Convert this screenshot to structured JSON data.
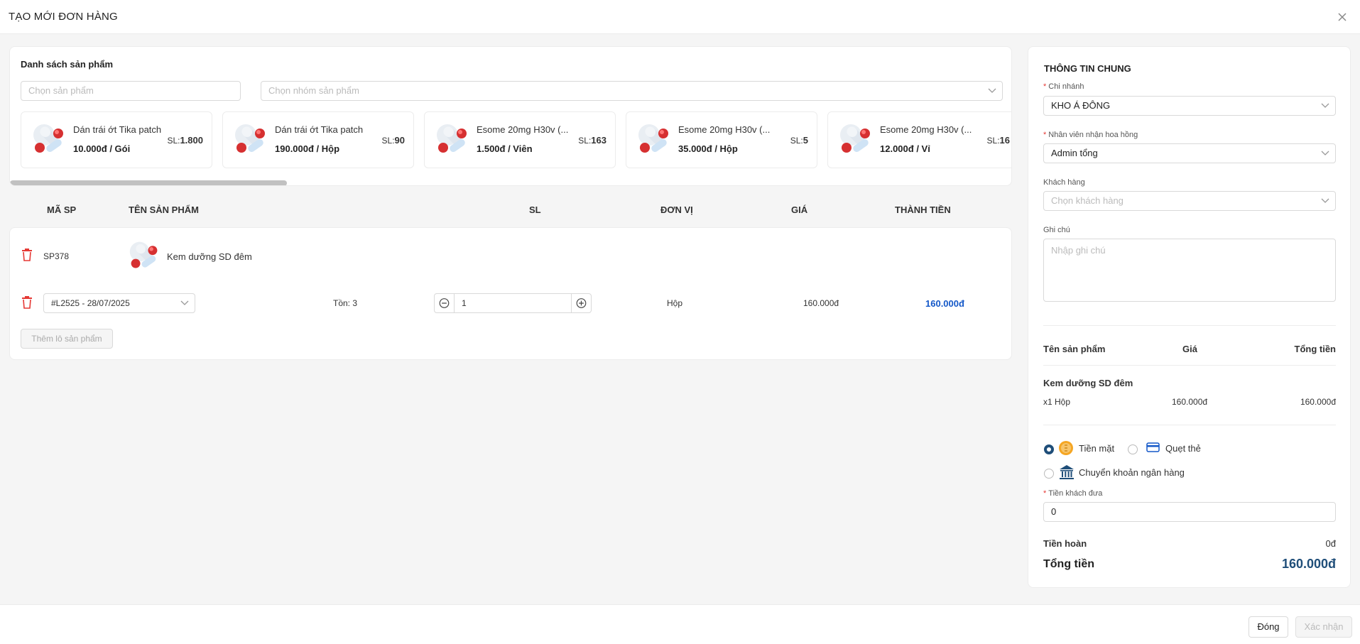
{
  "header": {
    "title": "TẠO MỚI ĐƠN HÀNG"
  },
  "product_list": {
    "heading": "Danh sách sản phẩm",
    "search_placeholder": "Chọn sản phẩm",
    "group_placeholder": "Chọn nhóm sản phẩm",
    "cards": [
      {
        "name": "Dán trái ớt Tika patch",
        "price": "10.000đ / Gói",
        "qty_label": "SL:",
        "qty": "1.800"
      },
      {
        "name": "Dán trái ớt Tika patch",
        "price": "190.000đ / Hộp",
        "qty_label": "SL:",
        "qty": "90"
      },
      {
        "name": "Esome 20mg H30v (...",
        "price": "1.500đ / Viên",
        "qty_label": "SL:",
        "qty": "163"
      },
      {
        "name": "Esome 20mg H30v (...",
        "price": "35.000đ / Hộp",
        "qty_label": "SL:",
        "qty": "5"
      },
      {
        "name": "Esome 20mg H30v (...",
        "price": "12.000đ / Vỉ",
        "qty_label": "SL:",
        "qty": "16"
      }
    ]
  },
  "table": {
    "headers": {
      "code": "MÃ SP",
      "name": "TÊN SẢN PHẨM",
      "qty": "SL",
      "unit": "ĐƠN VỊ",
      "price": "GIÁ",
      "total": "THÀNH TIỀN"
    },
    "row": {
      "code": "SP378",
      "name": "Kem dưỡng SD đêm",
      "lot": "#L2525 - 28/07/2025",
      "stock": "Tồn: 3",
      "qty": "1",
      "unit": "Hộp",
      "price": "160.000đ",
      "total": "160.000đ"
    },
    "add_lot_label": "Thêm lô sản phẩm"
  },
  "general": {
    "title": "THÔNG TIN CHUNG",
    "branch_label": "Chi nhánh",
    "branch_value": "KHO Á ĐÔNG",
    "staff_label": "Nhân viên nhận hoa hồng",
    "staff_value": "Admin tổng",
    "customer_label": "Khách hàng",
    "customer_placeholder": "Chọn khách hàng",
    "note_label": "Ghi chú",
    "note_placeholder": "Nhập ghi chú"
  },
  "summary": {
    "col_name": "Tên sản phẩm",
    "col_price": "Giá",
    "col_total": "Tổng tiền",
    "item_name": "Kem dưỡng SD đêm",
    "item_qty": "x1 Hộp",
    "item_price": "160.000đ",
    "item_total": "160.000đ"
  },
  "payment": {
    "cash": "Tiền mặt",
    "card": "Quẹt thẻ",
    "transfer": "Chuyển khoản ngân hàng",
    "selected": "cash",
    "given_label": "Tiền khách đưa",
    "given_value": "0",
    "change_label": "Tiền hoàn",
    "change_value": "0đ",
    "grand_label": "Tổng tiền",
    "grand_value": "160.000đ"
  },
  "footer": {
    "close_label": "Đóng",
    "confirm_label": "Xác nhận"
  },
  "colors": {
    "accent": "#1f4e79",
    "link_total": "#1458c8",
    "danger": "#e53935"
  }
}
